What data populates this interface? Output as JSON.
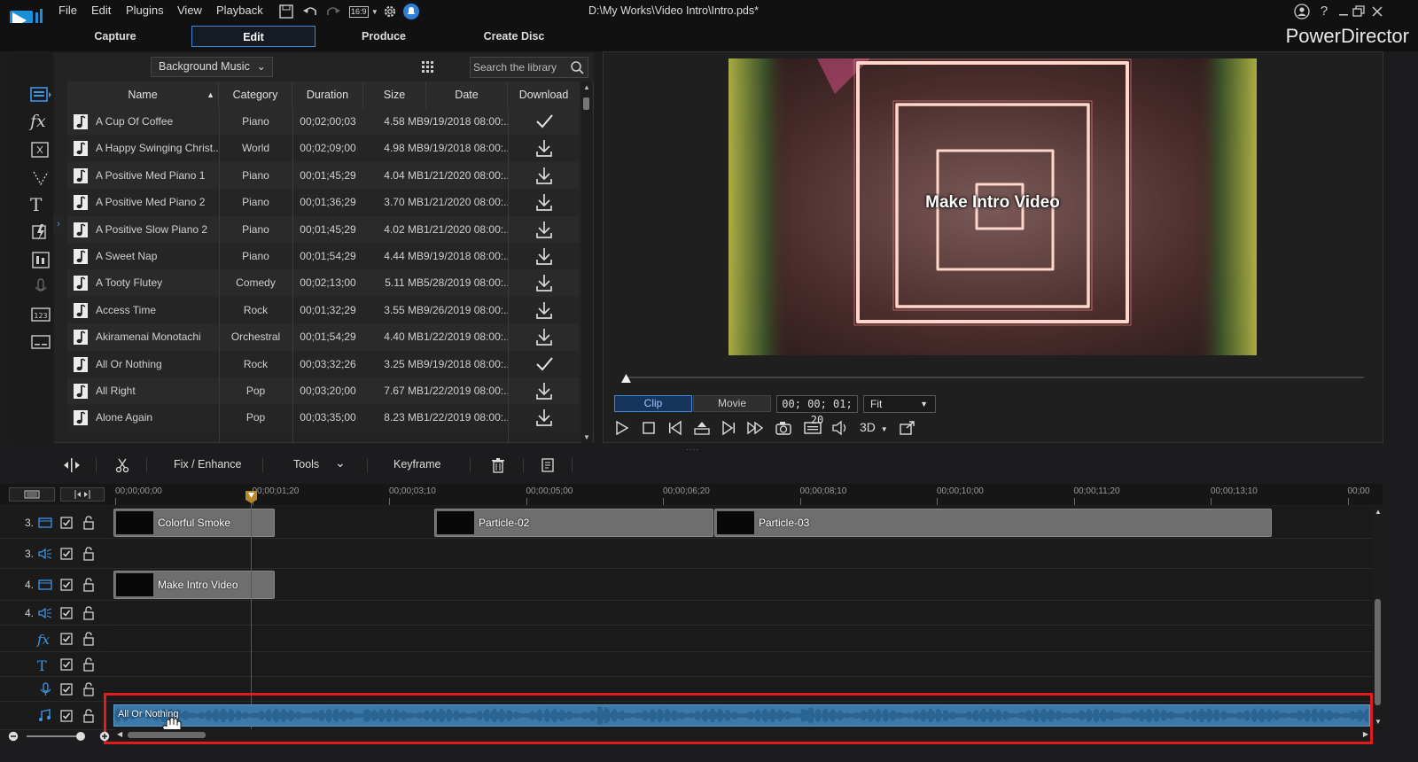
{
  "window": {
    "title": "D:\\My Works\\Video Intro\\Intro.pds*",
    "brand": "PowerDirector",
    "aspect_ratio": "16:9"
  },
  "menu": [
    "File",
    "Edit",
    "Plugins",
    "View",
    "Playback"
  ],
  "mode_tabs": [
    {
      "label": "Capture",
      "active": false
    },
    {
      "label": "Edit",
      "active": true
    },
    {
      "label": "Produce",
      "active": false
    },
    {
      "label": "Create Disc",
      "active": false
    }
  ],
  "library": {
    "category_select": "Background Music",
    "search_placeholder": "Search the library",
    "columns": [
      "Name",
      "Category",
      "Duration",
      "Size",
      "Date",
      "Download"
    ],
    "rows": [
      {
        "name": "A Cup Of Coffee",
        "category": "Piano",
        "duration": "00;02;00;03",
        "size": "4.58 MB",
        "date": "9/19/2018 08:00:...",
        "downloaded": true
      },
      {
        "name": "A Happy Swinging Christ...",
        "category": "World",
        "duration": "00;02;09;00",
        "size": "4.98 MB",
        "date": "9/19/2018 08:00:...",
        "downloaded": false
      },
      {
        "name": "A Positive Med Piano 1",
        "category": "Piano",
        "duration": "00;01;45;29",
        "size": "4.04 MB",
        "date": "1/21/2020 08:00:...",
        "downloaded": false
      },
      {
        "name": "A Positive Med Piano 2",
        "category": "Piano",
        "duration": "00;01;36;29",
        "size": "3.70 MB",
        "date": "1/21/2020 08:00:...",
        "downloaded": false
      },
      {
        "name": "A Positive Slow Piano 2",
        "category": "Piano",
        "duration": "00;01;45;29",
        "size": "4.02 MB",
        "date": "1/21/2020 08:00:...",
        "downloaded": false
      },
      {
        "name": "A Sweet Nap",
        "category": "Piano",
        "duration": "00;01;54;29",
        "size": "4.44 MB",
        "date": "9/19/2018 08:00:...",
        "downloaded": false
      },
      {
        "name": "A Tooty Flutey",
        "category": "Comedy",
        "duration": "00;02;13;00",
        "size": "5.11 MB",
        "date": "5/28/2019 08:00:...",
        "downloaded": false
      },
      {
        "name": "Access Time",
        "category": "Rock",
        "duration": "00;01;32;29",
        "size": "3.55 MB",
        "date": "9/26/2019 08:00:...",
        "downloaded": false
      },
      {
        "name": "Akiramenai Monotachi",
        "category": "Orchestral",
        "duration": "00;01;54;29",
        "size": "4.40 MB",
        "date": "1/22/2019 08:00:...",
        "downloaded": false
      },
      {
        "name": "All Or Nothing",
        "category": "Rock",
        "duration": "00;03;32;26",
        "size": "3.25 MB",
        "date": "9/19/2018 08:00:...",
        "downloaded": true
      },
      {
        "name": "All Right",
        "category": "Pop",
        "duration": "00;03;20;00",
        "size": "7.67 MB",
        "date": "1/22/2019 08:00:...",
        "downloaded": false
      },
      {
        "name": "Alone Again",
        "category": "Pop",
        "duration": "00;03;35;00",
        "size": "8.23 MB",
        "date": "1/22/2019 08:00:...",
        "downloaded": false
      }
    ]
  },
  "preview": {
    "overlay_title": "Make Intro Video",
    "clip_label": "Clip",
    "movie_label": "Movie",
    "timecode": "00; 00; 01; 20",
    "fit": "Fit",
    "stereo_label": "3D"
  },
  "edit_toolbar": {
    "fix_enhance": "Fix / Enhance",
    "tools": "Tools",
    "keyframe": "Keyframe"
  },
  "timeline": {
    "ruler": [
      "00;00;00;00",
      "00;00;01;20",
      "00;00;03;10",
      "00;00;05;00",
      "00;00;06;20",
      "00;00;08;10",
      "00;00;10;00",
      "00;00;11;20",
      "00;00;13;10",
      "00;00"
    ],
    "tracks": [
      {
        "num": "3.",
        "kind": "video",
        "clips": [
          "Colorful Smoke",
          "Particle-02",
          "Particle-03"
        ]
      },
      {
        "num": "3.",
        "kind": "audio",
        "clips": []
      },
      {
        "num": "4.",
        "kind": "video",
        "clips": [
          "Make Intro Video"
        ]
      },
      {
        "num": "4.",
        "kind": "audio",
        "clips": []
      },
      {
        "num": "",
        "kind": "fx",
        "clips": []
      },
      {
        "num": "",
        "kind": "title",
        "clips": []
      },
      {
        "num": "",
        "kind": "voice",
        "clips": []
      },
      {
        "num": "",
        "kind": "music",
        "clips": [
          "All Or Nothing"
        ]
      }
    ],
    "music_clip_label": "All Or Nothing"
  },
  "colors": {
    "accent": "#3e86d6",
    "highlight_box": "#e21c1c",
    "playhead": "#c0302a",
    "audio_clip": "#3a79aa"
  }
}
